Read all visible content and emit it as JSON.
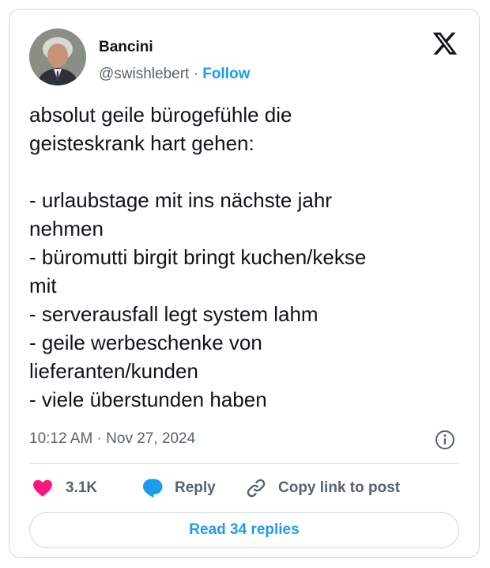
{
  "author": {
    "display_name": "Bancini",
    "handle": "@swishlebert",
    "separator": "·",
    "follow_label": "Follow"
  },
  "tweet": {
    "text": "absolut geile bürogefühle die\ngeisteskrank hart gehen:\n\n- urlaubstage mit ins nächste jahr\nnehmen\n- büromutti birgit bringt kuchen/kekse\nmit\n- serverausfall legt system lahm\n- geile werbeschenke von\nlieferanten/kunden\n- viele überstunden haben",
    "timestamp": "10:12 AM · Nov 27, 2024"
  },
  "actions": {
    "like_count": "3.1K",
    "reply_label": "Reply",
    "copy_link_label": "Copy link to post"
  },
  "read_replies_label": "Read 34 replies",
  "colors": {
    "accent": "#1d9bf0",
    "like": "#f91880",
    "muted": "#536471",
    "border": "#cfd9de"
  },
  "icons": [
    "x-logo-icon",
    "info-icon",
    "heart-icon",
    "reply-bubble-icon",
    "link-icon"
  ]
}
